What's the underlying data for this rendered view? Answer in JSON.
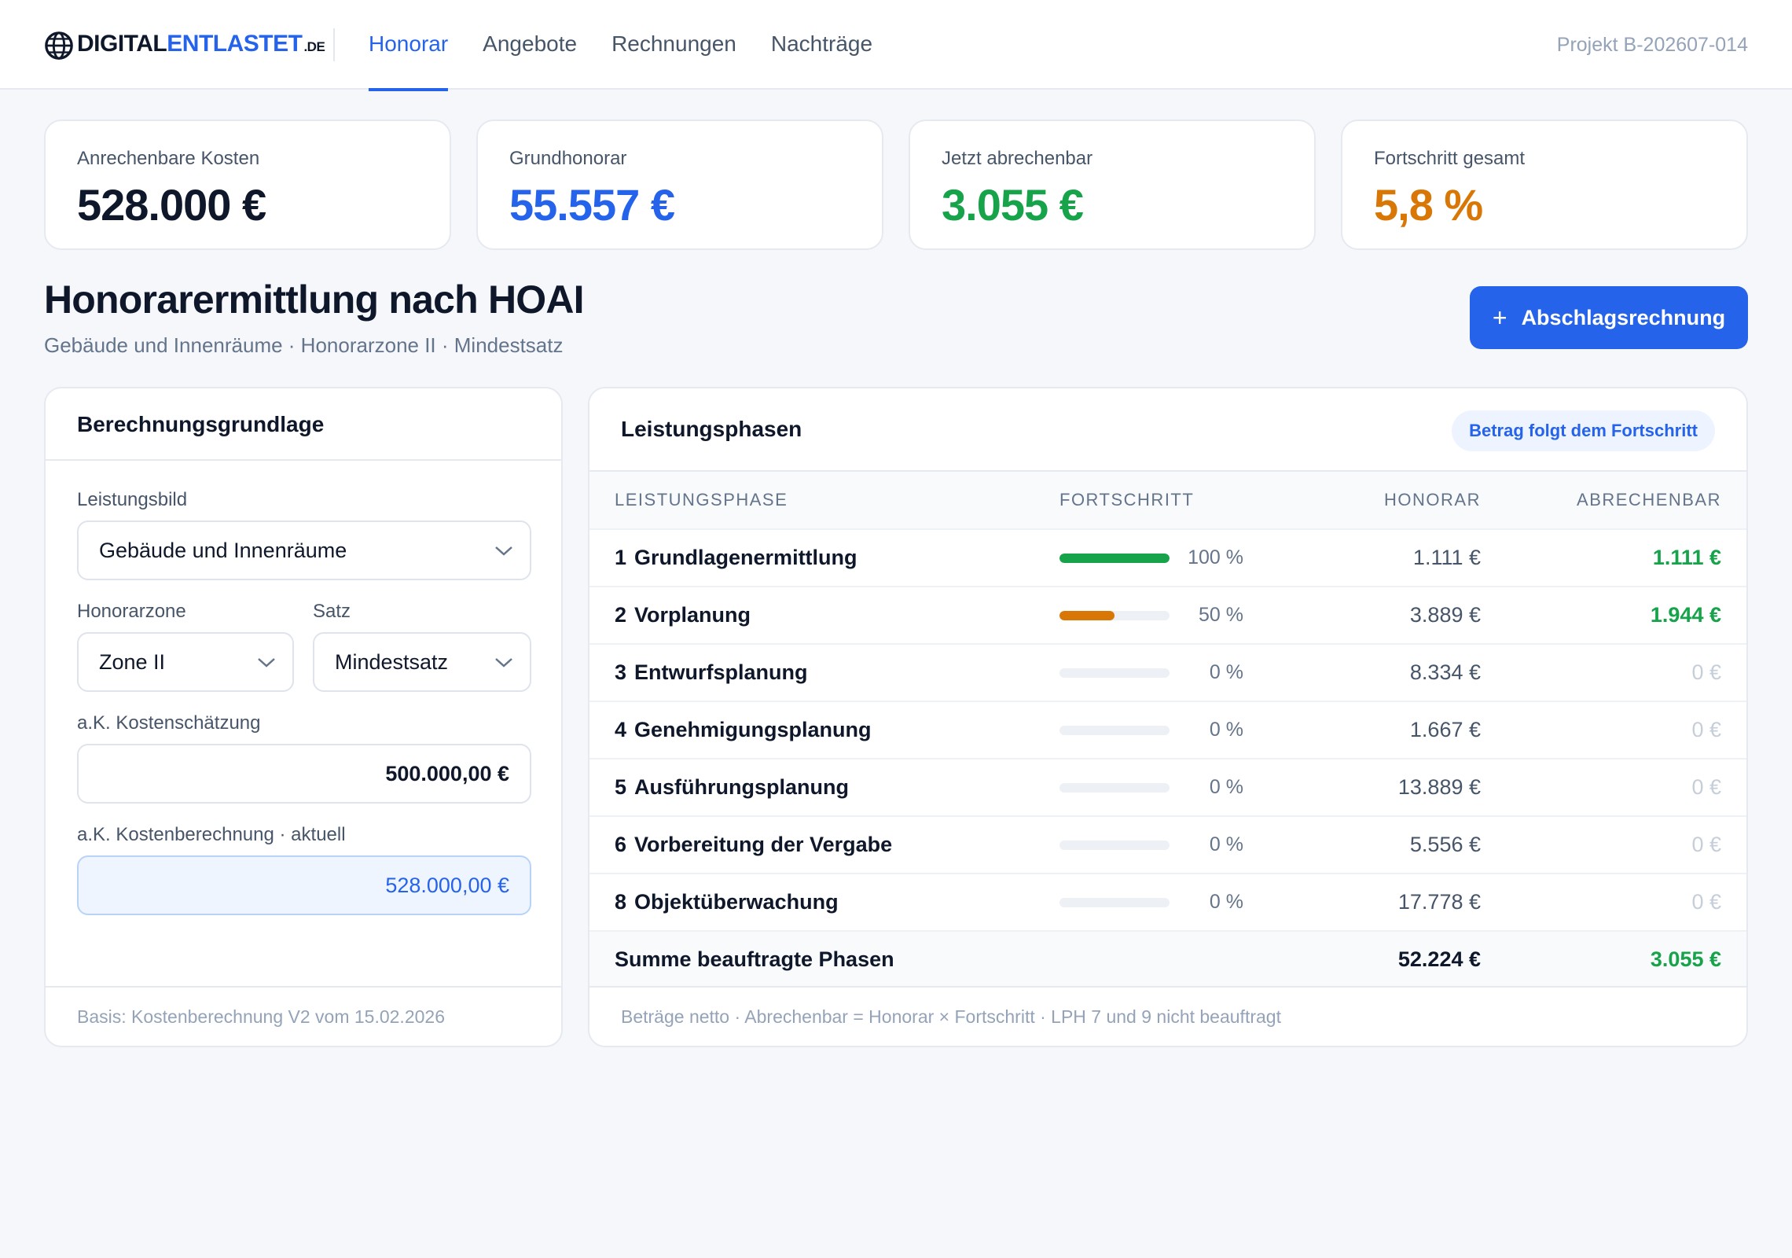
{
  "header": {
    "logo": {
      "part1": "DIGITAL",
      "part2": "ENTLASTET",
      "suffix": ".DE"
    },
    "tabs": [
      {
        "label": "Honorar",
        "active": true
      },
      {
        "label": "Angebote",
        "active": false
      },
      {
        "label": "Rechnungen",
        "active": false
      },
      {
        "label": "Nachträge",
        "active": false
      }
    ],
    "project": "Projekt B-202607-014"
  },
  "kpis": [
    {
      "label": "Anrechenbare Kosten",
      "value": "528.000 €",
      "color": "#0f172a"
    },
    {
      "label": "Grundhonorar",
      "value": "55.557 €",
      "color": "#2563eb"
    },
    {
      "label": "Jetzt abrechenbar",
      "value": "3.055 €",
      "color": "#16a34a"
    },
    {
      "label": "Fortschritt gesamt",
      "value": "5,8 %",
      "color": "#d97706"
    }
  ],
  "page": {
    "title": "Honorarermittlung nach HOAI",
    "subtitle": "Gebäude und Innenräume · Honorarzone II · Mindestsatz",
    "primary_button": {
      "icon": "+",
      "label": "Abschlagsrechnung"
    }
  },
  "basis": {
    "title": "Berechnungsgrundlage",
    "leistungsbild_label": "Leistungsbild",
    "leistungsbild_value": "Gebäude und Innenräume",
    "zone_label": "Honorarzone",
    "zone_value": "Zone II",
    "satz_label": "Satz",
    "satz_value": "Mindestsatz",
    "schaetzung_label": "a.K. Kostenschätzung",
    "schaetzung_value": "500.000,00 €",
    "berechnung_label": "a.K. Kostenberechnung · aktuell",
    "berechnung_value": "528.000,00 €",
    "footer": "Basis: Kostenberechnung V2 vom 15.02.2026"
  },
  "phases": {
    "title": "Leistungsphasen",
    "badge": "Betrag folgt dem Fortschritt",
    "columns": [
      "LEISTUNGSPHASE",
      "FORTSCHRITT",
      "HONORAR",
      "ABRECHENBAR"
    ],
    "rows": [
      {
        "num": "1",
        "name": "Grundlagenermittlung",
        "progress": 100,
        "progress_label": "100 %",
        "honorar": "1.111 €",
        "abrechenbar": "1.111 €",
        "bar_color": "#16a34a"
      },
      {
        "num": "2",
        "name": "Vorplanung",
        "progress": 50,
        "progress_label": "50 %",
        "honorar": "3.889 €",
        "abrechenbar": "1.944 €",
        "bar_color": "#d97706"
      },
      {
        "num": "3",
        "name": "Entwurfsplanung",
        "progress": 0,
        "progress_label": "0 %",
        "honorar": "8.334 €",
        "abrechenbar": "0 €",
        "bar_color": "#94a3b8"
      },
      {
        "num": "4",
        "name": "Genehmigungsplanung",
        "progress": 0,
        "progress_label": "0 %",
        "honorar": "1.667 €",
        "abrechenbar": "0 €",
        "bar_color": "#94a3b8"
      },
      {
        "num": "5",
        "name": "Ausführungsplanung",
        "progress": 0,
        "progress_label": "0 %",
        "honorar": "13.889 €",
        "abrechenbar": "0 €",
        "bar_color": "#94a3b8"
      },
      {
        "num": "6",
        "name": "Vorbereitung der Vergabe",
        "progress": 0,
        "progress_label": "0 %",
        "honorar": "5.556 €",
        "abrechenbar": "0 €",
        "bar_color": "#94a3b8"
      },
      {
        "num": "8",
        "name": "Objektüberwachung",
        "progress": 0,
        "progress_label": "0 %",
        "honorar": "17.778 €",
        "abrechenbar": "0 €",
        "bar_color": "#94a3b8"
      }
    ],
    "sum": {
      "label": "Summe beauftragte Phasen",
      "honorar": "52.224 €",
      "abrechenbar": "3.055 €"
    },
    "footer": "Beträge netto · Abrechenbar = Honorar × Fortschritt · LPH 7 und 9 nicht beauftragt"
  }
}
